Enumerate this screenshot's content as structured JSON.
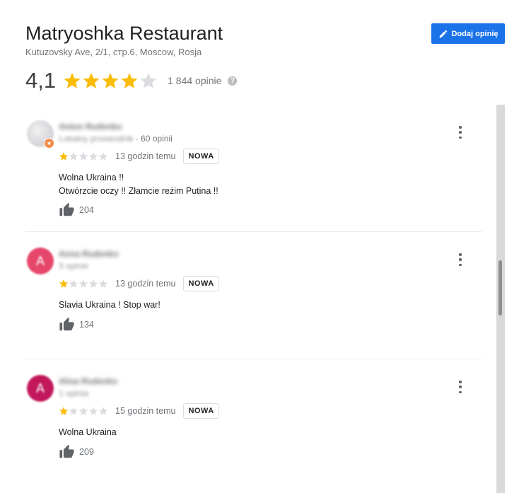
{
  "place": {
    "title": "Matryoshka Restaurant",
    "address": "Kutuzovsky Ave, 2/1, стр.6, Moscow, Rosja",
    "rating": "4,1",
    "stars": 4.1,
    "review_count": "1 844 opinie",
    "add_review_label": "Dodaj opinię"
  },
  "colors": {
    "accent": "#1a73e8",
    "star": "#fbbc04",
    "star_empty": "#dadce0",
    "avatar_pink": "#e6466a",
    "avatar_magenta": "#c2185b"
  },
  "reviews": [
    {
      "name": "Anton Rudenko",
      "meta_blur": "Lokalny przewodnik",
      "meta": "· 60 opinii",
      "avatar": "photo",
      "avatar_letter": "",
      "stars": 1,
      "time": "13 godzin temu",
      "badge": "NOWA",
      "text_lines": [
        "Wolna Ukraina !!",
        "Otwórzcie oczy !! Złamcie reżim Putina !!"
      ],
      "likes": "204"
    },
    {
      "name": "Anna Rudenko",
      "meta_blur": "3 opinie",
      "meta": "",
      "avatar": "letter",
      "avatar_letter": "A",
      "stars": 1,
      "time": "13 godzin temu",
      "badge": "NOWA",
      "text_lines": [
        "Slavia Ukraina ! Stop war!"
      ],
      "likes": "134"
    },
    {
      "name": "Alisa Rudenko",
      "meta_blur": "1 opinia",
      "meta": "",
      "avatar": "letter",
      "avatar_letter": "A",
      "stars": 1,
      "time": "15 godzin temu",
      "badge": "NOWA",
      "text_lines": [
        "Wolna Ukraina"
      ],
      "likes": "209"
    }
  ]
}
